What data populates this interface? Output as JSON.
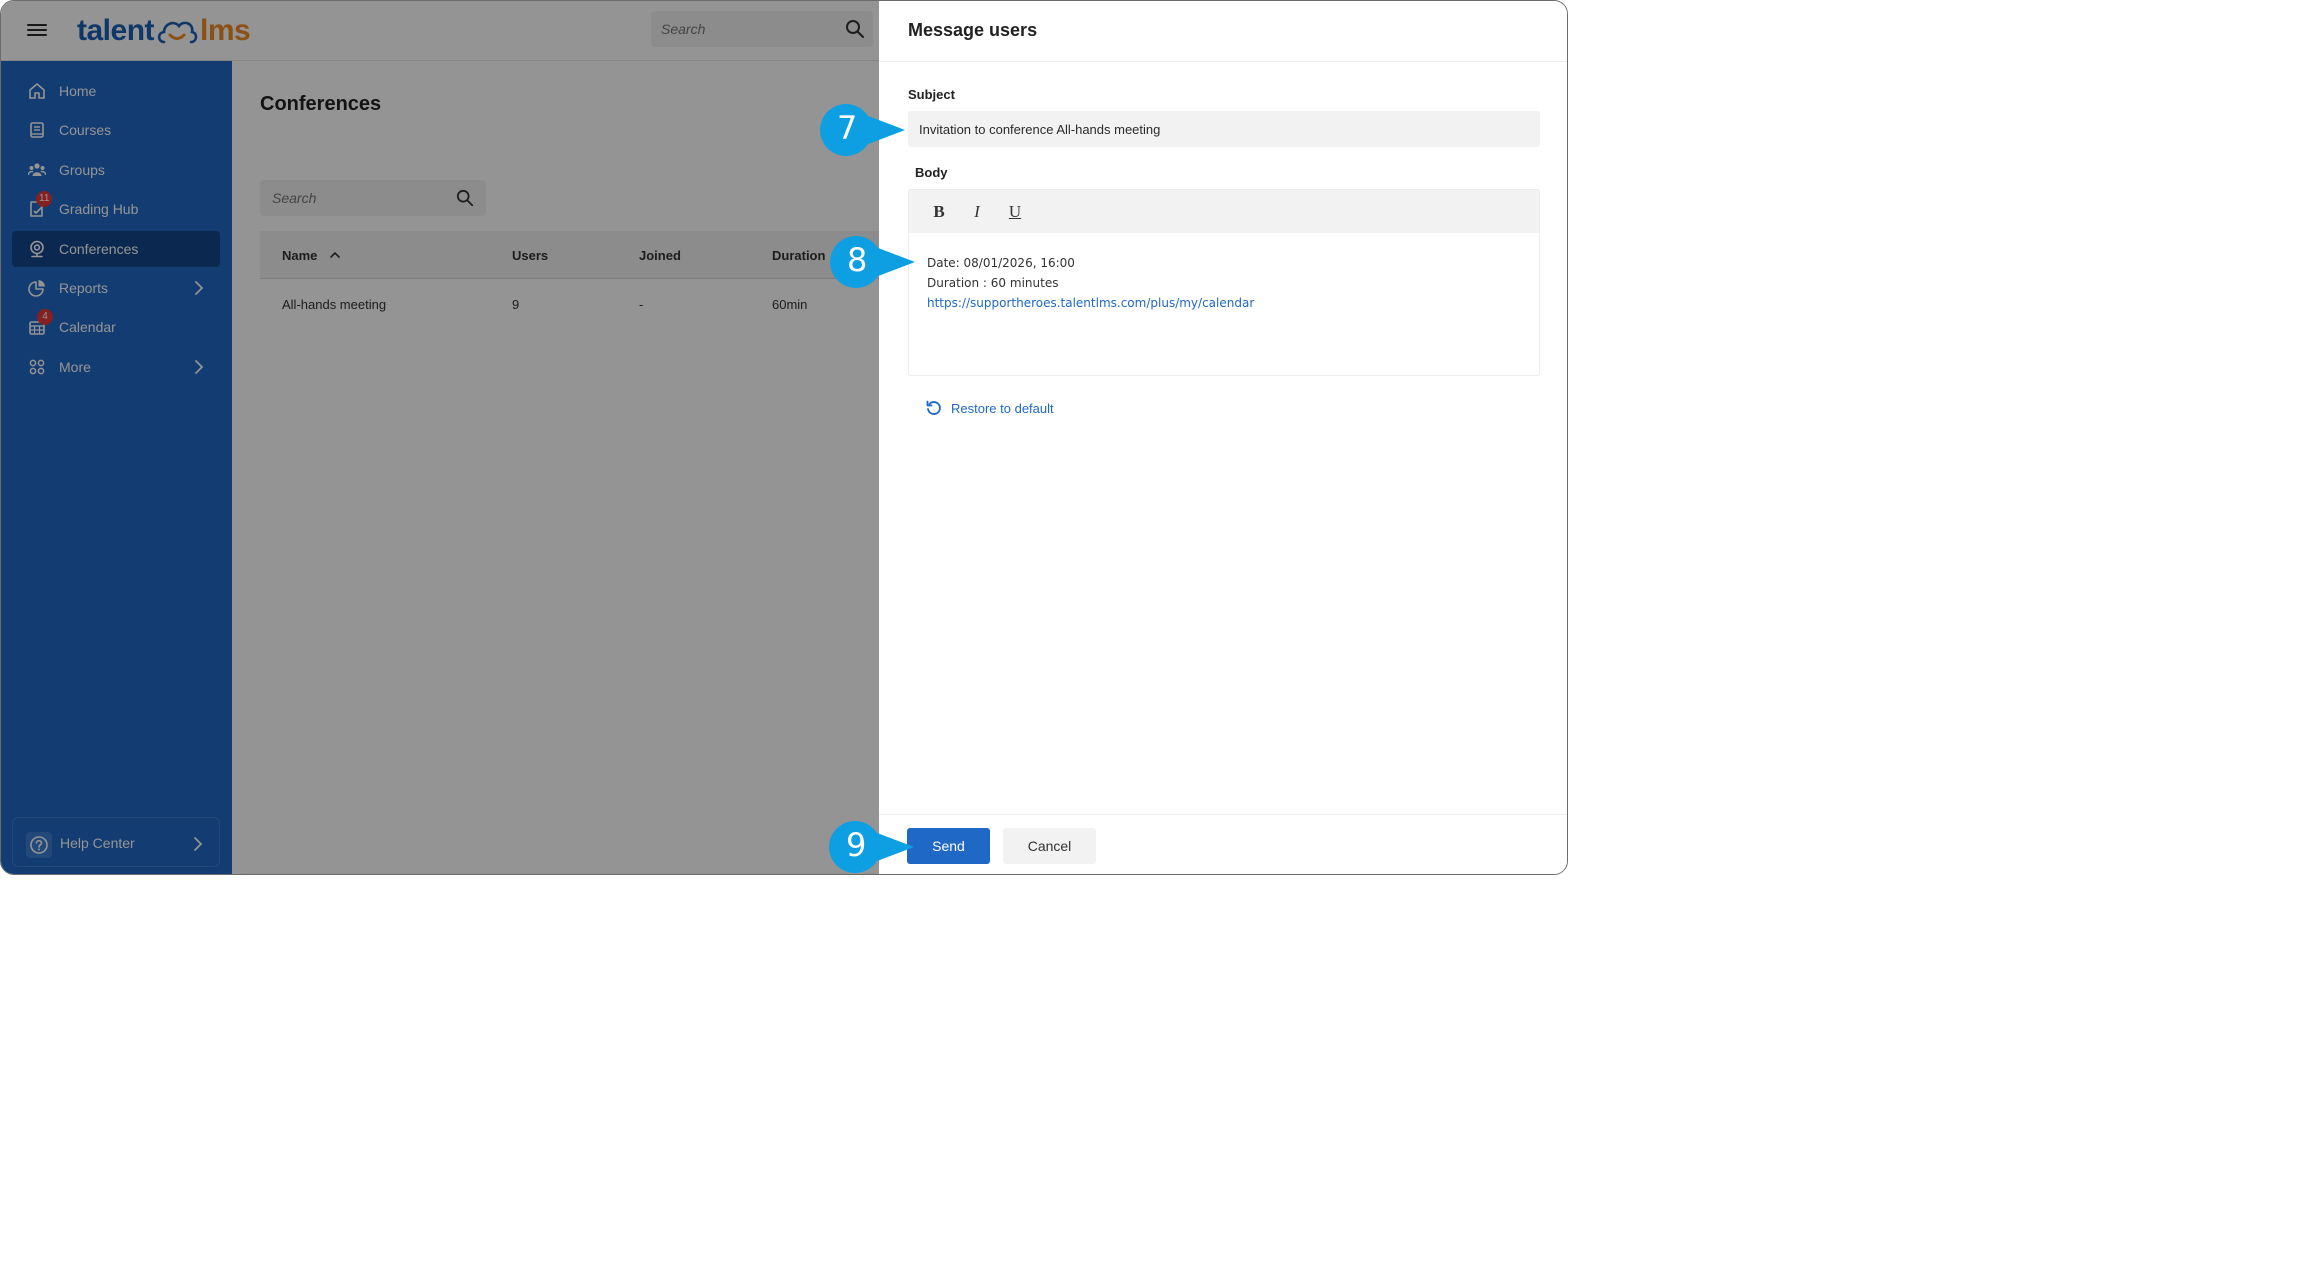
{
  "topbar": {
    "logo_talent": "talent",
    "logo_lms": "lms",
    "search_placeholder": "Search"
  },
  "sidebar": {
    "items": [
      {
        "label": "Home",
        "icon": "home-icon"
      },
      {
        "label": "Courses",
        "icon": "book-icon"
      },
      {
        "label": "Groups",
        "icon": "users-icon"
      },
      {
        "label": "Grading Hub",
        "icon": "grading-icon",
        "badge": "11"
      },
      {
        "label": "Conferences",
        "icon": "webcam-icon",
        "active": true
      },
      {
        "label": "Reports",
        "icon": "pie-chart-icon"
      },
      {
        "label": "Calendar",
        "icon": "calendar-icon",
        "badge": "4"
      },
      {
        "label": "More",
        "icon": "grid-icon"
      }
    ],
    "help_label": "Help Center"
  },
  "main": {
    "title": "Conferences",
    "search_placeholder": "Search",
    "columns": [
      "Name",
      "Users",
      "Joined",
      "Duration"
    ],
    "rows": [
      {
        "name": "All-hands meeting",
        "users": "9",
        "joined": "-",
        "duration": "60min"
      }
    ]
  },
  "drawer": {
    "title": "Message users",
    "subject_label": "Subject",
    "subject_value": "Invitation to conference All-hands meeting",
    "body_label": "Body",
    "toolbar": {
      "bold": "B",
      "italic": "I",
      "underline": "U"
    },
    "body_lines": {
      "date": "Date: 08/01/2026, 16:00",
      "duration": "Duration : 60 minutes",
      "link": "https://supportheroes.talentlms.com/plus/my/calendar"
    },
    "restore_label": "Restore to default",
    "send_label": "Send",
    "cancel_label": "Cancel"
  },
  "callouts": [
    "7",
    "8",
    "9"
  ],
  "colors": {
    "brand_blue": "#1f68c5",
    "sidebar_active": "#14468a",
    "logo_orange": "#f08a24",
    "badge_red": "#e5383b",
    "callout_blue": "#0e9fe3"
  }
}
